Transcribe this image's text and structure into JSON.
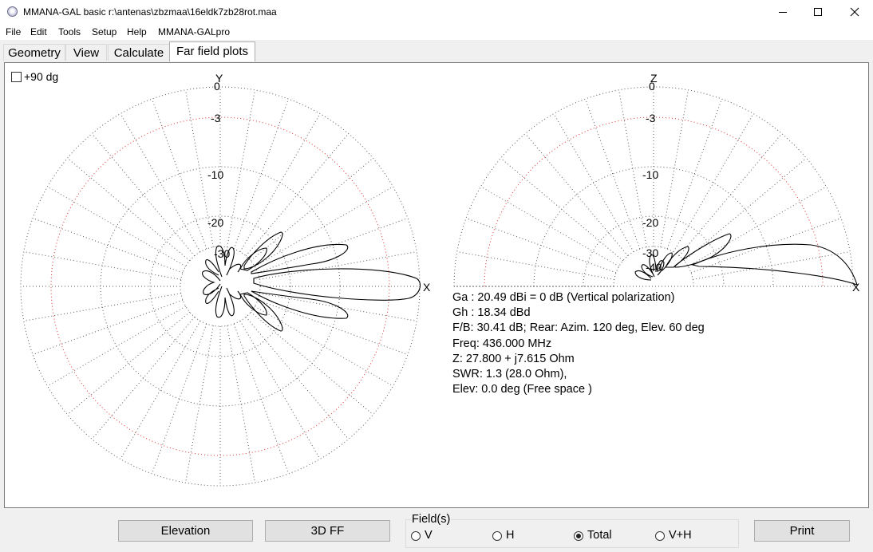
{
  "window": {
    "title": "MMANA-GAL basic r:\\antenas\\zbzmaa\\16eldk7zb28rot.maa",
    "icon": "antenna-app-icon",
    "controls": [
      "minimize-icon",
      "maximize-icon",
      "close-icon"
    ]
  },
  "menu": [
    "File",
    "Edit",
    "Tools",
    "Setup",
    "Help",
    "MMANA-GALpro"
  ],
  "tabs": [
    {
      "label": "Geometry",
      "active": false
    },
    {
      "label": "View",
      "active": false
    },
    {
      "label": "Calculate",
      "active": false
    },
    {
      "label": "Far field plots",
      "active": true
    }
  ],
  "checkbox": {
    "label": "+90 dg",
    "checked": false
  },
  "plots": {
    "azimuth": {
      "axis_top": "Y",
      "axis_right": "X"
    },
    "elevation": {
      "axis_top": "Z",
      "axis_right": "X"
    },
    "ring_labels": [
      "0",
      "-3",
      "-10",
      "-20",
      "-30",
      "-40"
    ]
  },
  "info": [
    "Ga : 20.49 dBi = 0 dB  (Vertical polarization)",
    "Gh : 18.34 dBd",
    "F/B: 30.41 dB; Rear: Azim. 120 deg,  Elev. 60 deg",
    "Freq: 436.000 MHz",
    "Z: 27.800 + j7.615 Ohm",
    "SWR: 1.3 (28.0 Ohm),",
    "Elev: 0.0 deg (Free space )"
  ],
  "buttons": {
    "elevation": "Elevation",
    "ff3d": "3D FF",
    "print": "Print"
  },
  "fields": {
    "title": "Field(s)",
    "options": [
      {
        "label": "V",
        "selected": false
      },
      {
        "label": "H",
        "selected": false
      },
      {
        "label": "Total",
        "selected": true
      },
      {
        "label": "V+H",
        "selected": false
      }
    ]
  },
  "colors": {
    "grid_gray": "#5a5a5a",
    "grid_red": "#e03030",
    "pattern": "#000000"
  }
}
